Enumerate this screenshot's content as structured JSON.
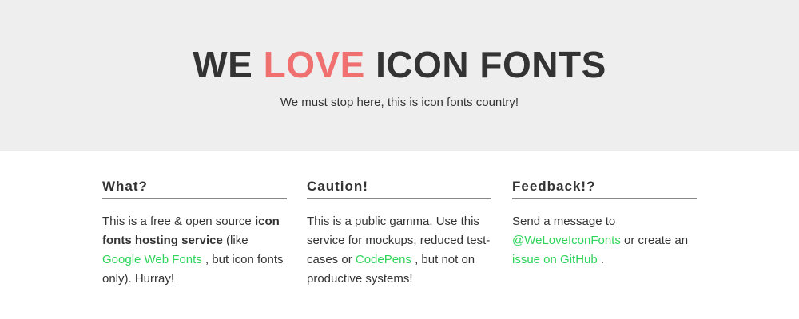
{
  "hero": {
    "title_part1": "WE",
    "title_love": "LOVE",
    "title_part2": "ICON FONTS",
    "tagline": "We must stop here, this is icon fonts country!"
  },
  "columns": {
    "what": {
      "heading": "What?",
      "text1": "This is a free & open source ",
      "bold": "icon fonts hosting service",
      "text2": " (like ",
      "link": "Google Web Fonts",
      "text3": " , but icon fonts only). Hurray!"
    },
    "caution": {
      "heading": "Caution!",
      "text1": "This is a public gamma. Use this service for mockups, reduced test-cases or ",
      "link": "CodePens",
      "text2": " , but not on productive systems!"
    },
    "feedback": {
      "heading": "Feedback!?",
      "text1": "Send a message to ",
      "link1": "@WeLoveIconFonts",
      "text2": " or create an ",
      "link2": "issue on GitHub",
      "text3": " ."
    }
  },
  "colors": {
    "accent": "#f07070",
    "link": "#2fd45a",
    "hero_bg": "#eeeeee",
    "text": "#333333"
  }
}
